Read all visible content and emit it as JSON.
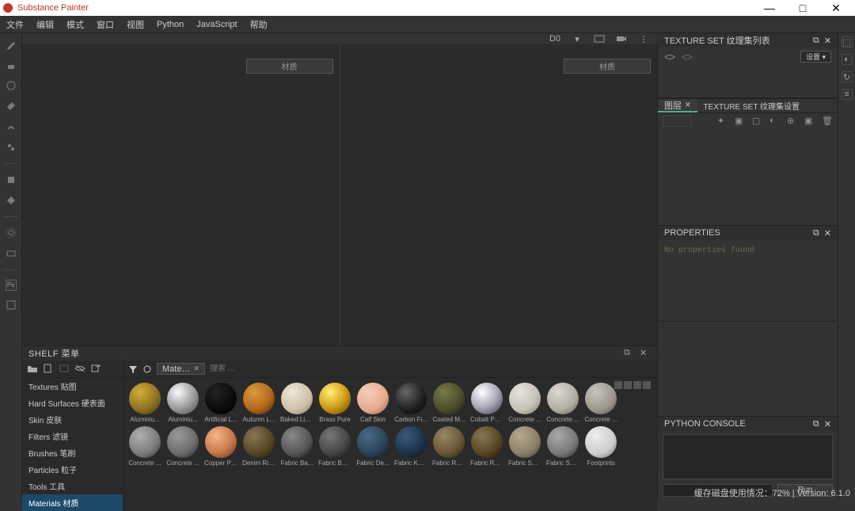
{
  "app": {
    "title": "Substance Painter"
  },
  "winbtns": {
    "min": "—",
    "max": "□",
    "close": "✕"
  },
  "menubar": [
    "文件",
    "编辑",
    "模式",
    "窗口",
    "视图",
    "Python",
    "JavaScript",
    "帮助"
  ],
  "viewport": {
    "label_left": "材质",
    "label_right": "材质",
    "d0": "D0"
  },
  "shelf": {
    "title": "SHELF 菜单",
    "categories": [
      "Textures 贴图",
      "Hard Surfaces 硬表面",
      "Skin 皮肤",
      "Filters 滤镜",
      "Brushes 笔刷",
      "Particles 粒子",
      "Tools 工具",
      "Materials 材质"
    ],
    "active_index": 7,
    "filter_chip": "Mate…",
    "search_placeholder": "搜索 ...",
    "materials_row1": [
      {
        "name": "Aluminiu...",
        "bg": "radial-gradient(circle at 35% 30%,#d4af37,#8a6d1f 60%,#3a2e0c)"
      },
      {
        "name": "Aluminiu...",
        "bg": "radial-gradient(circle at 35% 30%,#fafafa,#999 55%,#444)"
      },
      {
        "name": "Artificial L...",
        "bg": "radial-gradient(circle at 35% 30%,#222,#0a0a0a 60%,#000)"
      },
      {
        "name": "Autumn L...",
        "bg": "radial-gradient(circle at 35% 30%,#d99a3d,#b56a1a 55%,#3a1e05)"
      },
      {
        "name": "Baked Lig...",
        "bg": "radial-gradient(circle at 35% 30%,#f0e6d8,#cdbfa8 60%,#7a6e58)"
      },
      {
        "name": "Brass Pure",
        "bg": "radial-gradient(circle at 35% 30%,#fff07a,#d4a017 50%,#5a3e05)"
      },
      {
        "name": "Calf Skin",
        "bg": "radial-gradient(circle at 35% 30%,#f7cdb8,#e5a98c 60%,#8a5a42)"
      },
      {
        "name": "Carbon Fi...",
        "bg": "radial-gradient(circle at 35% 30%,#666,#222 55%,#000)"
      },
      {
        "name": "Coated M...",
        "bg": "radial-gradient(circle at 35% 30%,#7a7a4a,#4a4a2a 60%,#1a1a0a)"
      },
      {
        "name": "Cobalt Pure",
        "bg": "radial-gradient(circle at 35% 30%,#fff,#aab 50%,#334)"
      },
      {
        "name": "Concrete ...",
        "bg": "radial-gradient(circle at 35% 30%,#e8e4de,#c4bfb5 60%,#6a665c)"
      },
      {
        "name": "Concrete ...",
        "bg": "radial-gradient(circle at 35% 30%,#dcd8d0,#b0aca2 60%,#5a564c)"
      },
      {
        "name": "Concrete ...",
        "bg": "radial-gradient(circle at 35% 30%,#c8c4bc,#9a968c 60%,#4a463c)"
      }
    ],
    "materials_row2": [
      {
        "name": "Concrete ...",
        "bg": "radial-gradient(circle at 35% 30%,#b0b0b0,#7a7a7a 60%,#2a2a2a)"
      },
      {
        "name": "Concrete ...",
        "bg": "radial-gradient(circle at 35% 30%,#9a9a9a,#6a6a6a 60%,#1a1a1a)"
      },
      {
        "name": "Copper Pure",
        "bg": "radial-gradient(circle at 35% 30%,#f7b58a,#c77a4a 55%,#5a2e15)"
      },
      {
        "name": "Denim Rivet",
        "bg": "radial-gradient(circle at 35% 30%,#887755,#554422 60%,#1a1405)"
      },
      {
        "name": "Fabric Ba...",
        "bg": "radial-gradient(circle at 35% 30%,#888,#555 60%,#111)"
      },
      {
        "name": "Fabric Bas...",
        "bg": "radial-gradient(circle at 35% 30%,#777,#444 60%,#0a0a0a)"
      },
      {
        "name": "Fabric De...",
        "bg": "radial-gradient(circle at 35% 30%,#4a6a88,#2a4258 60%,#0a151e)"
      },
      {
        "name": "Fabric Knit...",
        "bg": "radial-gradient(circle at 35% 30%,#3a5a7a,#1a3248 60%,#050f18)"
      },
      {
        "name": "Fabric Rou...",
        "bg": "radial-gradient(circle at 35% 30%,#998866,#665533 60%,#221a0a)"
      },
      {
        "name": "Fabric Rou...",
        "bg": "radial-gradient(circle at 35% 30%,#887755,#554422 60%,#1a1405)"
      },
      {
        "name": "Fabric Soft...",
        "bg": "radial-gradient(circle at 35% 30%,#b5a890,#8a7e66 60%,#3a3222)"
      },
      {
        "name": "Fabric Suit...",
        "bg": "radial-gradient(circle at 35% 30%,#aaa,#777 60%,#222)"
      },
      {
        "name": "Footprints",
        "bg": "radial-gradient(circle at 35% 30%,#eee,#ccc 60%,#666)"
      }
    ]
  },
  "side": {
    "texture_set_list": {
      "title": "TEXTURE SET 纹理集列表",
      "dropdown": "设置 ▾"
    },
    "layers": {
      "tab_active": "图层",
      "tab_other": "TEXTURE SET 纹理集设置"
    },
    "properties": {
      "title": "PROPERTIES",
      "empty": "No properties found"
    },
    "python": {
      "title": "PYTHON CONSOLE",
      "run": "Run"
    }
  },
  "status": {
    "disk": "缓存磁盘使用情况：",
    "pct": "72%",
    "sep": " | ",
    "ver": "Version: 6.1.0"
  }
}
